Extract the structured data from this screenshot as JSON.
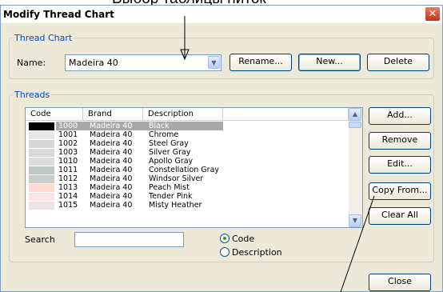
{
  "annotation_top": "Выбор таблицы ниток",
  "window": {
    "title": "Modify Thread Chart",
    "close_glyph": "✕"
  },
  "thread_chart": {
    "legend": "Thread Chart",
    "name_label": "Name:",
    "name_value": "Madeira 40",
    "buttons": {
      "rename": "Rename...",
      "new": "New...",
      "delete": "Delete"
    }
  },
  "threads": {
    "legend": "Threads",
    "columns": [
      "Code",
      "Brand",
      "Description"
    ],
    "rows": [
      {
        "code": "1000",
        "brand": "Madeira 40",
        "desc": "Black",
        "color": "#000000",
        "selected": true
      },
      {
        "code": "1001",
        "brand": "Madeira 40",
        "desc": "Chrome",
        "color": "#e6e6e6",
        "selected": false
      },
      {
        "code": "1002",
        "brand": "Madeira 40",
        "desc": "Steel Gray",
        "color": "#d6d6d6",
        "selected": false
      },
      {
        "code": "1003",
        "brand": "Madeira 40",
        "desc": "Silver Gray",
        "color": "#d9d9d9",
        "selected": false
      },
      {
        "code": "1010",
        "brand": "Madeira 40",
        "desc": "Apollo Gray",
        "color": "#dcdcdc",
        "selected": false
      },
      {
        "code": "1011",
        "brand": "Madeira 40",
        "desc": "Constellation Gray",
        "color": "#bdc7c4",
        "selected": false
      },
      {
        "code": "1012",
        "brand": "Madeira 40",
        "desc": "Windsor Silver",
        "color": "#c9cccb",
        "selected": false
      },
      {
        "code": "1013",
        "brand": "Madeira 40",
        "desc": "Peach Mist",
        "color": "#fcd9d1",
        "selected": false
      },
      {
        "code": "1014",
        "brand": "Madeira 40",
        "desc": "Tender Pink",
        "color": "#fbe3e8",
        "selected": false
      },
      {
        "code": "1015",
        "brand": "Madeira 40",
        "desc": "Misty Heather",
        "color": "#ece4e2",
        "selected": false
      }
    ],
    "buttons": {
      "add": "Add...",
      "remove": "Remove",
      "edit": "Edit...",
      "copy_from": "Copy From...",
      "clear_all": "Clear All"
    },
    "search_label": "Search",
    "search_value": "",
    "radio": {
      "code": "Code",
      "description": "Description",
      "selected": "Code"
    }
  },
  "footer": {
    "close": "Close"
  },
  "icons": {
    "dropdown": "chevron-down-icon",
    "scroll_up": "scroll-up-icon",
    "scroll_down": "scroll-down-icon",
    "window_close": "close-icon"
  }
}
